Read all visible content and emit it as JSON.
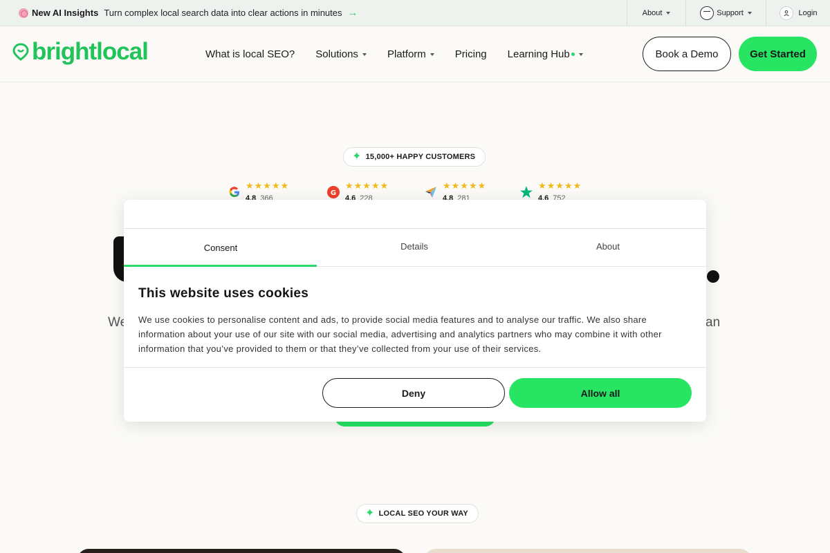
{
  "topbar": {
    "promo_strong": "New AI Insights",
    "promo_text": "Turn complex local search data into clear actions in minutes",
    "promo_arrow": "→",
    "about": "About",
    "support": "Support",
    "login": "Login"
  },
  "nav": {
    "logo": "brightlocal",
    "links": [
      "What is local SEO?",
      "Solutions",
      "Platform",
      "Pricing",
      "Learning Hub"
    ],
    "book_demo": "Book a Demo",
    "get_started": "Get Started"
  },
  "hero": {
    "badge": "15,000+ HAPPY CUSTOMERS",
    "sub_left": "We",
    "sub_right": "an",
    "ratings": [
      {
        "source_icon": "google-icon",
        "stars": "★★★★★",
        "score": "4.8",
        "reviews": "366 Reviews"
      },
      {
        "source_icon": "g2-icon",
        "stars": "★★★★★",
        "score": "4.6",
        "reviews": "228 Reviews"
      },
      {
        "source_icon": "capterra-icon",
        "stars": "★★★★★",
        "score": "4.8",
        "reviews": "281 Reviews"
      },
      {
        "source_icon": "trustpilot-icon",
        "stars": "★★★★★",
        "score": "4.6",
        "reviews": "752 Reviews"
      }
    ]
  },
  "cookie": {
    "tabs": [
      "Consent",
      "Details",
      "About"
    ],
    "title": "This website uses cookies",
    "text": "We use cookies to personalise content and ads, to provide social media features and to analyse our traffic. We also share information about your use of our site with our social media, advertising and analytics partners who may combine it with other information that you’ve provided to them or that they’ve collected from your use of their services.",
    "deny": "Deny",
    "allow_all": "Allow all"
  },
  "section": {
    "badge": "LOCAL SEO YOUR WAY"
  },
  "colors": {
    "accent": "#27e463",
    "brand_logo": "#22c35a",
    "star": "#f1b91a"
  }
}
